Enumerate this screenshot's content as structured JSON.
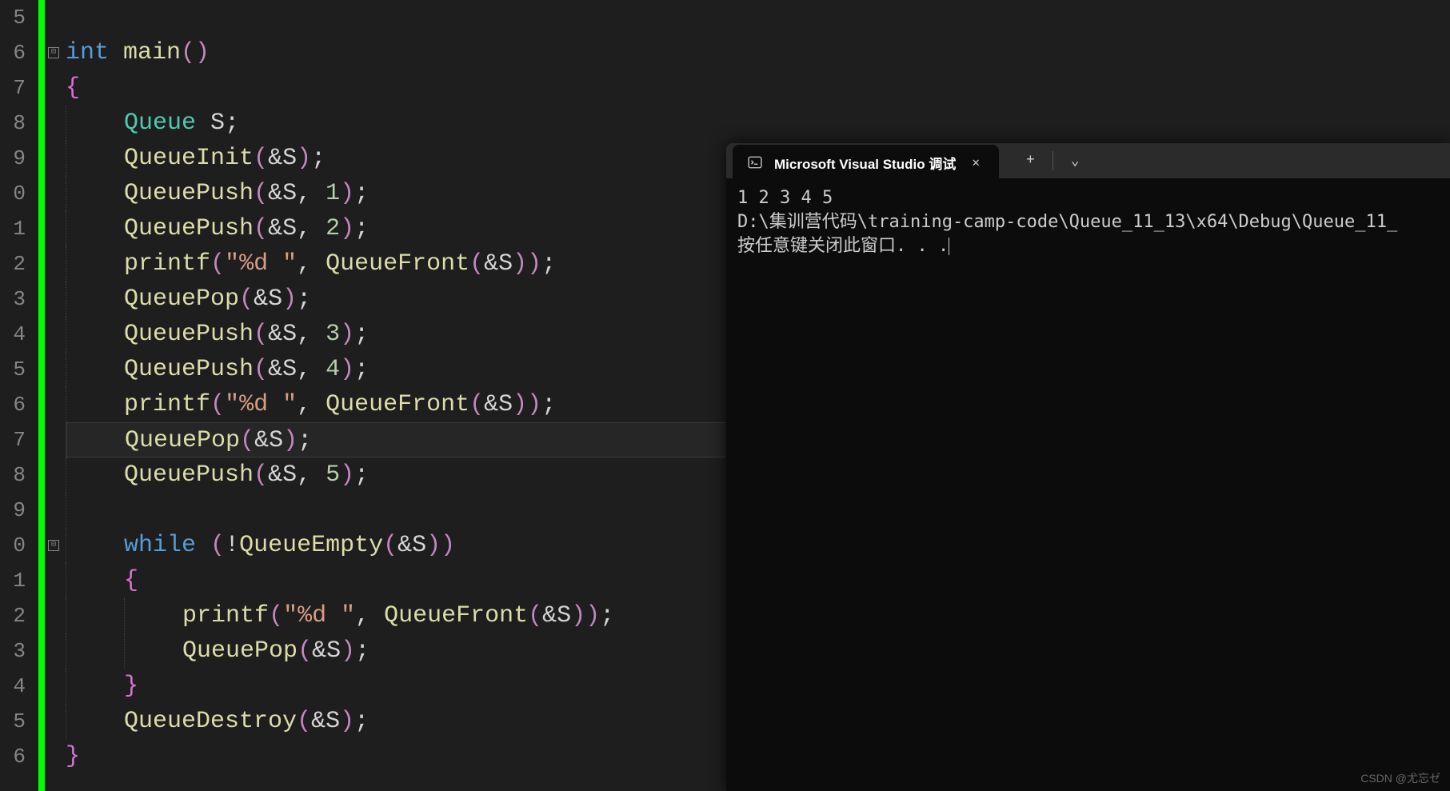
{
  "gutter": [
    "5",
    "6",
    "7",
    "8",
    "9",
    "0",
    "1",
    "2",
    "3",
    "4",
    "5",
    "6",
    "7",
    "8",
    "9",
    "0",
    "1",
    "2",
    "3",
    "4",
    "5",
    "6"
  ],
  "currentLineIndex": 12,
  "foldMarks": [
    {
      "line": 1,
      "symbol": "⊟"
    },
    {
      "line": 15,
      "symbol": "⊟"
    }
  ],
  "code": [
    {
      "t": [],
      "indent": 0
    },
    {
      "t": [
        {
          "c": "tk-keyword",
          "v": "int"
        },
        {
          "c": "tk-punct",
          "v": " "
        },
        {
          "c": "tk-func",
          "v": "main"
        },
        {
          "c": "tk-paren",
          "v": "()"
        }
      ],
      "indent": 0
    },
    {
      "t": [
        {
          "c": "tk-brace",
          "v": "{"
        }
      ],
      "indent": 0
    },
    {
      "t": [
        {
          "c": "tk-type",
          "v": "Queue"
        },
        {
          "c": "tk-punct",
          "v": " "
        },
        {
          "c": "tk-ident",
          "v": "S"
        },
        {
          "c": "tk-punct",
          "v": ";"
        }
      ],
      "indent": 1
    },
    {
      "t": [
        {
          "c": "tk-func",
          "v": "QueueInit"
        },
        {
          "c": "tk-paren",
          "v": "("
        },
        {
          "c": "tk-op",
          "v": "&"
        },
        {
          "c": "tk-ident",
          "v": "S"
        },
        {
          "c": "tk-paren",
          "v": ")"
        },
        {
          "c": "tk-punct",
          "v": ";"
        }
      ],
      "indent": 1
    },
    {
      "t": [
        {
          "c": "tk-func",
          "v": "QueuePush"
        },
        {
          "c": "tk-paren",
          "v": "("
        },
        {
          "c": "tk-op",
          "v": "&"
        },
        {
          "c": "tk-ident",
          "v": "S"
        },
        {
          "c": "tk-punct",
          "v": ", "
        },
        {
          "c": "tk-num",
          "v": "1"
        },
        {
          "c": "tk-paren",
          "v": ")"
        },
        {
          "c": "tk-punct",
          "v": ";"
        }
      ],
      "indent": 1
    },
    {
      "t": [
        {
          "c": "tk-func",
          "v": "QueuePush"
        },
        {
          "c": "tk-paren",
          "v": "("
        },
        {
          "c": "tk-op",
          "v": "&"
        },
        {
          "c": "tk-ident",
          "v": "S"
        },
        {
          "c": "tk-punct",
          "v": ", "
        },
        {
          "c": "tk-num",
          "v": "2"
        },
        {
          "c": "tk-paren",
          "v": ")"
        },
        {
          "c": "tk-punct",
          "v": ";"
        }
      ],
      "indent": 1
    },
    {
      "t": [
        {
          "c": "tk-func",
          "v": "printf"
        },
        {
          "c": "tk-paren",
          "v": "("
        },
        {
          "c": "tk-str",
          "v": "\"%d \""
        },
        {
          "c": "tk-punct",
          "v": ", "
        },
        {
          "c": "tk-func",
          "v": "QueueFront"
        },
        {
          "c": "tk-paren",
          "v": "("
        },
        {
          "c": "tk-op",
          "v": "&"
        },
        {
          "c": "tk-ident",
          "v": "S"
        },
        {
          "c": "tk-paren",
          "v": "))"
        },
        {
          "c": "tk-punct",
          "v": ";"
        }
      ],
      "indent": 1
    },
    {
      "t": [
        {
          "c": "tk-func",
          "v": "QueuePop"
        },
        {
          "c": "tk-paren",
          "v": "("
        },
        {
          "c": "tk-op",
          "v": "&"
        },
        {
          "c": "tk-ident",
          "v": "S"
        },
        {
          "c": "tk-paren",
          "v": ")"
        },
        {
          "c": "tk-punct",
          "v": ";"
        }
      ],
      "indent": 1
    },
    {
      "t": [
        {
          "c": "tk-func",
          "v": "QueuePush"
        },
        {
          "c": "tk-paren",
          "v": "("
        },
        {
          "c": "tk-op",
          "v": "&"
        },
        {
          "c": "tk-ident",
          "v": "S"
        },
        {
          "c": "tk-punct",
          "v": ", "
        },
        {
          "c": "tk-num",
          "v": "3"
        },
        {
          "c": "tk-paren",
          "v": ")"
        },
        {
          "c": "tk-punct",
          "v": ";"
        }
      ],
      "indent": 1
    },
    {
      "t": [
        {
          "c": "tk-func",
          "v": "QueuePush"
        },
        {
          "c": "tk-paren",
          "v": "("
        },
        {
          "c": "tk-op",
          "v": "&"
        },
        {
          "c": "tk-ident",
          "v": "S"
        },
        {
          "c": "tk-punct",
          "v": ", "
        },
        {
          "c": "tk-num",
          "v": "4"
        },
        {
          "c": "tk-paren",
          "v": ")"
        },
        {
          "c": "tk-punct",
          "v": ";"
        }
      ],
      "indent": 1
    },
    {
      "t": [
        {
          "c": "tk-func",
          "v": "printf"
        },
        {
          "c": "tk-paren",
          "v": "("
        },
        {
          "c": "tk-str",
          "v": "\"%d \""
        },
        {
          "c": "tk-punct",
          "v": ", "
        },
        {
          "c": "tk-func",
          "v": "QueueFront"
        },
        {
          "c": "tk-paren",
          "v": "("
        },
        {
          "c": "tk-op",
          "v": "&"
        },
        {
          "c": "tk-ident",
          "v": "S"
        },
        {
          "c": "tk-paren",
          "v": "))"
        },
        {
          "c": "tk-punct",
          "v": ";"
        }
      ],
      "indent": 1
    },
    {
      "t": [
        {
          "c": "tk-func",
          "v": "QueuePop"
        },
        {
          "c": "tk-paren",
          "v": "("
        },
        {
          "c": "tk-op",
          "v": "&"
        },
        {
          "c": "tk-ident",
          "v": "S"
        },
        {
          "c": "tk-paren",
          "v": ")"
        },
        {
          "c": "tk-punct",
          "v": ";"
        }
      ],
      "indent": 1
    },
    {
      "t": [
        {
          "c": "tk-func",
          "v": "QueuePush"
        },
        {
          "c": "tk-paren",
          "v": "("
        },
        {
          "c": "tk-op",
          "v": "&"
        },
        {
          "c": "tk-ident",
          "v": "S"
        },
        {
          "c": "tk-punct",
          "v": ", "
        },
        {
          "c": "tk-num",
          "v": "5"
        },
        {
          "c": "tk-paren",
          "v": ")"
        },
        {
          "c": "tk-punct",
          "v": ";"
        }
      ],
      "indent": 1
    },
    {
      "t": [],
      "indent": 1
    },
    {
      "t": [
        {
          "c": "tk-keyword",
          "v": "while"
        },
        {
          "c": "tk-punct",
          "v": " "
        },
        {
          "c": "tk-paren",
          "v": "("
        },
        {
          "c": "tk-exclaim",
          "v": "!"
        },
        {
          "c": "tk-func",
          "v": "QueueEmpty"
        },
        {
          "c": "tk-paren",
          "v": "("
        },
        {
          "c": "tk-op",
          "v": "&"
        },
        {
          "c": "tk-ident",
          "v": "S"
        },
        {
          "c": "tk-paren",
          "v": "))"
        }
      ],
      "indent": 1
    },
    {
      "t": [
        {
          "c": "tk-brace",
          "v": "{"
        }
      ],
      "indent": 1
    },
    {
      "t": [
        {
          "c": "tk-func",
          "v": "printf"
        },
        {
          "c": "tk-paren",
          "v": "("
        },
        {
          "c": "tk-str",
          "v": "\"%d \""
        },
        {
          "c": "tk-punct",
          "v": ", "
        },
        {
          "c": "tk-func",
          "v": "QueueFront"
        },
        {
          "c": "tk-paren",
          "v": "("
        },
        {
          "c": "tk-op",
          "v": "&"
        },
        {
          "c": "tk-ident",
          "v": "S"
        },
        {
          "c": "tk-paren",
          "v": "))"
        },
        {
          "c": "tk-punct",
          "v": ";"
        }
      ],
      "indent": 2
    },
    {
      "t": [
        {
          "c": "tk-func",
          "v": "QueuePop"
        },
        {
          "c": "tk-paren",
          "v": "("
        },
        {
          "c": "tk-op",
          "v": "&"
        },
        {
          "c": "tk-ident",
          "v": "S"
        },
        {
          "c": "tk-paren",
          "v": ")"
        },
        {
          "c": "tk-punct",
          "v": ";"
        }
      ],
      "indent": 2
    },
    {
      "t": [
        {
          "c": "tk-brace",
          "v": "}"
        }
      ],
      "indent": 1
    },
    {
      "t": [
        {
          "c": "tk-func",
          "v": "QueueDestroy"
        },
        {
          "c": "tk-paren",
          "v": "("
        },
        {
          "c": "tk-op",
          "v": "&"
        },
        {
          "c": "tk-ident",
          "v": "S"
        },
        {
          "c": "tk-paren",
          "v": ")"
        },
        {
          "c": "tk-punct",
          "v": ";"
        }
      ],
      "indent": 1
    },
    {
      "t": [
        {
          "c": "tk-brace",
          "v": "}"
        }
      ],
      "indent": 0
    }
  ],
  "console": {
    "tabTitle": "Microsoft Visual Studio 调试",
    "closeSymbol": "✕",
    "addSymbol": "+",
    "dropdownSymbol": "⌄",
    "output": [
      "1 2 3 4 5",
      "D:\\集训营代码\\training-camp-code\\Queue_11_13\\x64\\Debug\\Queue_11_",
      "按任意键关闭此窗口. . ."
    ]
  },
  "watermark": "CSDN @尤忘ゼ"
}
